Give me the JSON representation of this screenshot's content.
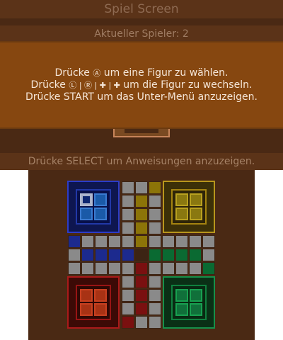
{
  "top_screen": {
    "title": "Spiel Screen",
    "current_player": "Aktueller Spieler: 2",
    "instructions": {
      "line1_pre": "Drücke ",
      "line1_button": "Ⓐ",
      "line1_post": " um eine Figur zu wählen.",
      "line2_pre": "Drücke ",
      "line2_buttons": "Ⓛ | Ⓡ | ✚ | ✚",
      "line2_post": " um die Figur zu wechseln.",
      "line3": "Drücke START um das Unter-Menü anzuzeigen."
    },
    "select_hint": "Drücke SELECT um Anweisungen anzuzeigen."
  },
  "board": {
    "players": [
      "blue",
      "yellow",
      "red",
      "green"
    ],
    "current_player_number": 2,
    "selected_piece": {
      "player": "blue",
      "index": 0
    },
    "colors": {
      "blue": "#1c2a8e",
      "yellow": "#8c7408",
      "green": "#0a6a32",
      "red": "#7a1010",
      "path": "#8a8a8a",
      "background": "#4a2914"
    }
  }
}
